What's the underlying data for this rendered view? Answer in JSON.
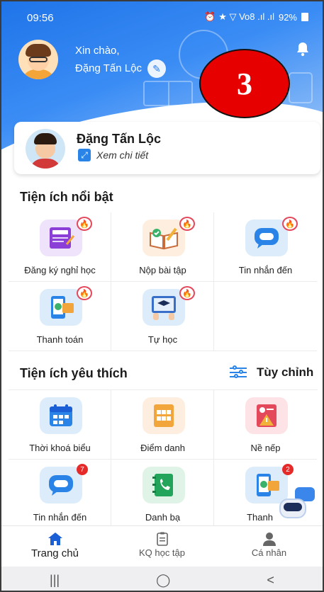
{
  "status_bar": {
    "time": "09:56",
    "indicators": "⏰ ★ ▽ Vo8 .ıl .ıl",
    "battery": "92%"
  },
  "header": {
    "greeting": "Xin chào,",
    "parent_name": "Đặng Tấn Lộc",
    "step_number": "3"
  },
  "student_card": {
    "name": "Đặng Tấn Lộc",
    "detail_link": "Xem chi tiết"
  },
  "featured": {
    "title": "Tiện ích nổi bật",
    "items": [
      {
        "label": "Đăng ký nghỉ học",
        "icon": "leave-form-icon"
      },
      {
        "label": "Nộp bài tập",
        "icon": "homework-icon"
      },
      {
        "label": "Tin nhắn đến",
        "icon": "message-icon"
      },
      {
        "label": "Thanh toán",
        "icon": "payment-icon"
      },
      {
        "label": "Tự học",
        "icon": "self-study-icon"
      }
    ]
  },
  "favorites": {
    "title": "Tiện ích yêu thích",
    "customize": "Tùy chỉnh",
    "items": [
      {
        "label": "Thời khoá biểu",
        "icon": "calendar-icon"
      },
      {
        "label": "Điểm danh",
        "icon": "attendance-icon"
      },
      {
        "label": "Nề nếp",
        "icon": "discipline-icon"
      },
      {
        "label": "Tin nhắn đến",
        "icon": "message-icon",
        "badge": "7"
      },
      {
        "label": "Danh bạ",
        "icon": "contacts-icon"
      },
      {
        "label": "Thanh",
        "icon": "payment-icon",
        "badge": "2"
      }
    ]
  },
  "bottom_nav": [
    {
      "label": "Trang chủ",
      "icon": "home-icon",
      "active": true
    },
    {
      "label": "KQ học tập",
      "icon": "report-icon"
    },
    {
      "label": "Cá nhân",
      "icon": "person-icon"
    }
  ],
  "system_nav": {
    "recent": "|||",
    "home": "◯",
    "back": "<"
  },
  "colors": {
    "primary": "#1f74e8",
    "badge_red": "#e60000",
    "fire_red": "#e3485b"
  }
}
